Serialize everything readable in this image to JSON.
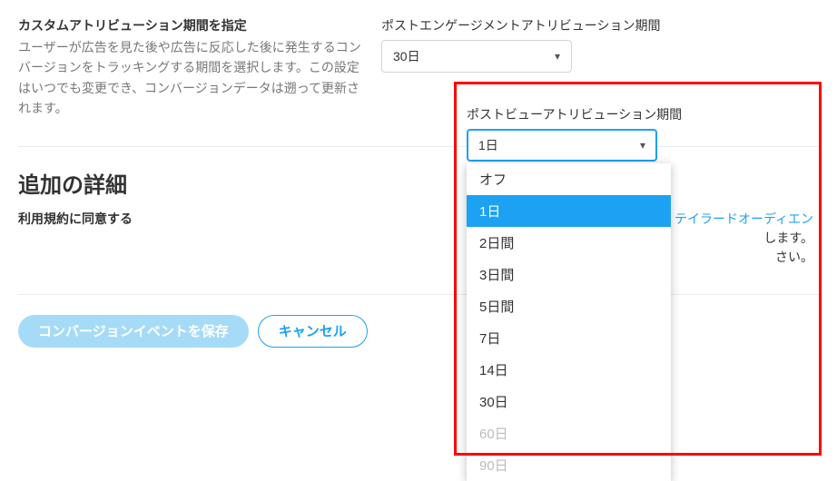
{
  "attribution": {
    "heading": "カスタムアトリビューション期間を指定",
    "description": "ユーザーが広告を見た後や広告に反応した後に発生するコンバージョンをトラッキングする期間を選択します。この設定はいつでも変更でき、コンバージョンデータは遡って更新されます。"
  },
  "post_engagement": {
    "label": "ポストエンゲージメントアトリビューション期間",
    "selected": "30日"
  },
  "post_view": {
    "label": "ポストビューアトリビューション期間",
    "selected": "1日",
    "options": [
      {
        "label": "オフ",
        "disabled": false,
        "highlight": false
      },
      {
        "label": "1日",
        "disabled": false,
        "highlight": true
      },
      {
        "label": "2日間",
        "disabled": false,
        "highlight": false
      },
      {
        "label": "3日間",
        "disabled": false,
        "highlight": false
      },
      {
        "label": "5日間",
        "disabled": false,
        "highlight": false
      },
      {
        "label": "7日",
        "disabled": false,
        "highlight": false
      },
      {
        "label": "14日",
        "disabled": false,
        "highlight": false
      },
      {
        "label": "30日",
        "disabled": false,
        "highlight": false
      },
      {
        "label": "60日",
        "disabled": true,
        "highlight": false
      },
      {
        "label": "90日",
        "disabled": true,
        "highlight": false
      }
    ]
  },
  "additional": {
    "heading": "追加の詳細",
    "terms_label": "利用規約に同意する",
    "terms_visible_fragments": {
      "t1": "、",
      "link": "テイラードオーディエン",
      "t2": "します。",
      "t3": "さい。"
    }
  },
  "buttons": {
    "save": "コンバージョンイベントを保存",
    "cancel": "キャンセル"
  }
}
